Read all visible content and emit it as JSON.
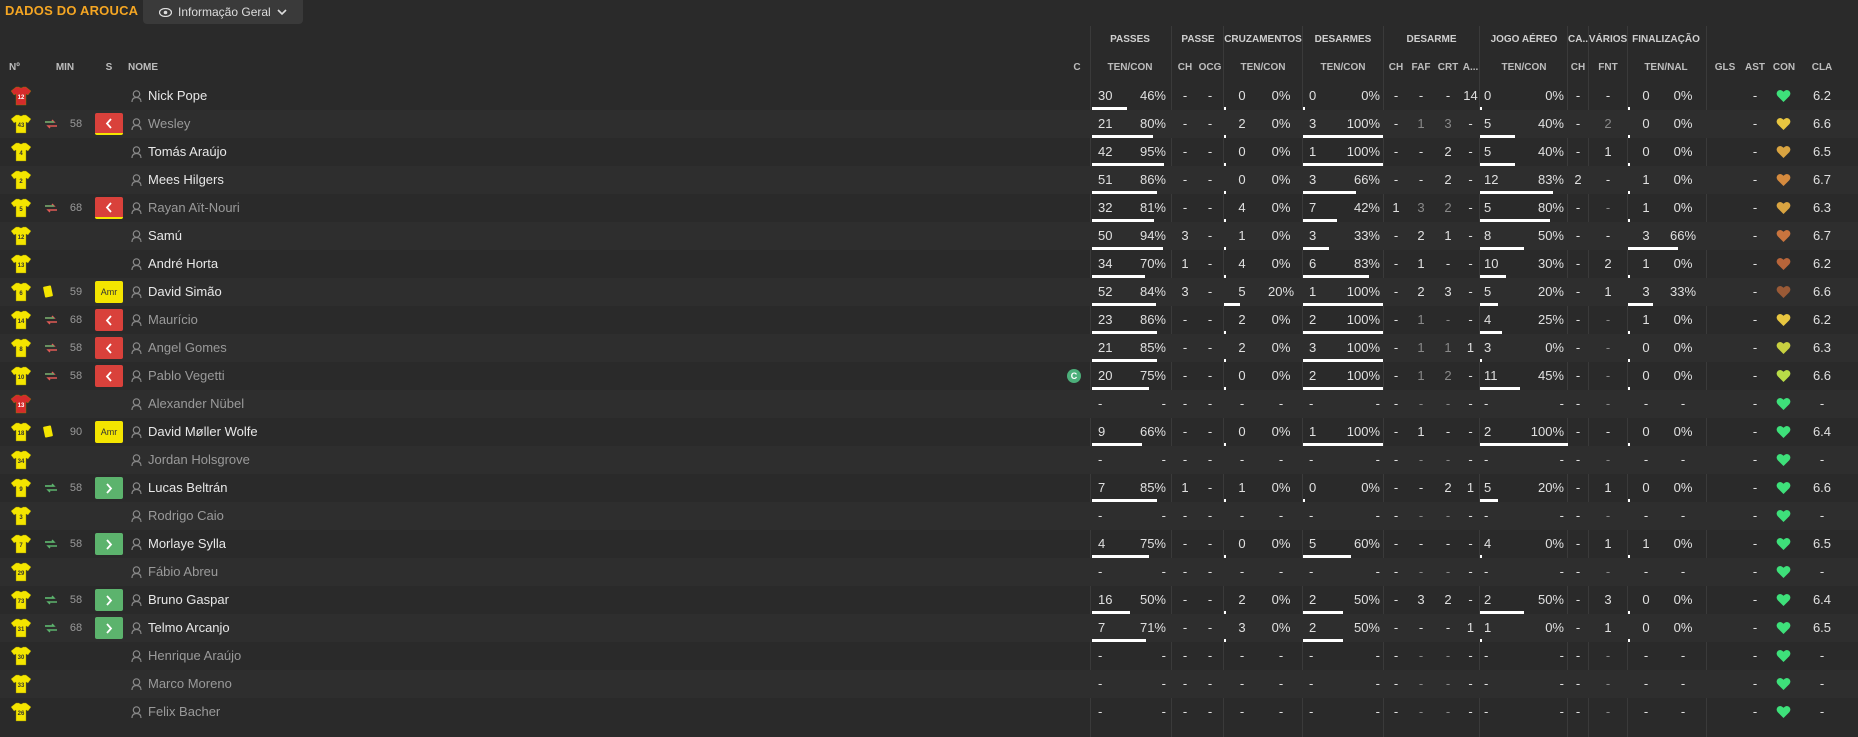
{
  "header": {
    "club_title": "DADOS DO AROUCA",
    "view_label": "Informação Geral",
    "groups": [
      "PASSES",
      "PASSE",
      "CRUZAMENTOS",
      "DESARMES",
      "DESARME",
      "JOGO AÉREO",
      "CA...",
      "VÁRIOS",
      "FINALIZAÇÃO"
    ],
    "columns": {
      "num": "Nº",
      "min": "MIN",
      "s": "S",
      "nome": "NOME",
      "c": "C",
      "pas": "TEN/CON",
      "pch": "CH",
      "pocg": "OCG",
      "cruz": "TEN/CON",
      "des": "TEN/CON",
      "dch": "CH",
      "dfaf": "FAF",
      "dcrt": "CRT",
      "da": "A...",
      "aer": "TEN/CON",
      "cach": "CH",
      "fnt": "FNT",
      "fin": "TEN/NAL",
      "gls": "GLS",
      "ast": "AST",
      "con": "CON",
      "cla": "CLA"
    }
  },
  "colors": {
    "accent": "#f5a623",
    "shirt": "#f4e500",
    "gk_shirt": "#d42b2b",
    "sub_on": "#5cb36d",
    "sub_off": "#d9413b"
  },
  "rows": [
    {
      "num": "12",
      "gk": true,
      "min": "",
      "event": "",
      "status": "",
      "name": "Nick Pope",
      "unused": false,
      "cap": false,
      "pas_t": "30",
      "pas_p": "46%",
      "pch": "-",
      "pocg": "-",
      "cr_t": "0",
      "cr_p": "0%",
      "de_t": "0",
      "de_p": "0%",
      "dch": "-",
      "dfaf": "-",
      "dcrt": "-",
      "da": "14",
      "ae_t": "0",
      "ae_p": "0%",
      "cach": "-",
      "fnt": "-",
      "fi_t": "0",
      "fi_p": "0%",
      "gls": "",
      "ast": "-",
      "con": "#3ee07a",
      "cla": "6.2"
    },
    {
      "num": "43",
      "gk": false,
      "min": "58",
      "event": "sub",
      "status": "off",
      "name": "Wesley",
      "unused": true,
      "cap": false,
      "pas_t": "21",
      "pas_p": "80%",
      "pch": "-",
      "pocg": "-",
      "cr_t": "2",
      "cr_p": "0%",
      "de_t": "3",
      "de_p": "100%",
      "dch": "-",
      "dfaf": "1",
      "dcrt": "3",
      "da": "-",
      "ae_t": "5",
      "ae_p": "40%",
      "cach": "-",
      "fnt": "2",
      "fi_t": "0",
      "fi_p": "0%",
      "gls": "",
      "ast": "-",
      "con": "#e8c640",
      "cla": "6.6"
    },
    {
      "num": "4",
      "gk": false,
      "min": "",
      "event": "",
      "status": "",
      "name": "Tomás Araújo",
      "unused": false,
      "cap": false,
      "pas_t": "42",
      "pas_p": "95%",
      "pch": "-",
      "pocg": "-",
      "cr_t": "0",
      "cr_p": "0%",
      "de_t": "1",
      "de_p": "100%",
      "dch": "-",
      "dfaf": "-",
      "dcrt": "2",
      "da": "-",
      "ae_t": "5",
      "ae_p": "40%",
      "cach": "-",
      "fnt": "1",
      "fi_t": "0",
      "fi_p": "0%",
      "gls": "",
      "ast": "-",
      "con": "#d9a441",
      "cla": "6.5"
    },
    {
      "num": "2",
      "gk": false,
      "min": "",
      "event": "",
      "status": "",
      "name": "Mees Hilgers",
      "unused": false,
      "cap": false,
      "pas_t": "51",
      "pas_p": "86%",
      "pch": "-",
      "pocg": "-",
      "cr_t": "0",
      "cr_p": "0%",
      "de_t": "3",
      "de_p": "66%",
      "dch": "-",
      "dfaf": "-",
      "dcrt": "2",
      "da": "-",
      "ae_t": "12",
      "ae_p": "83%",
      "cach": "2",
      "fnt": "-",
      "fi_t": "1",
      "fi_p": "0%",
      "gls": "",
      "ast": "-",
      "con": "#d58a3e",
      "cla": "6.7"
    },
    {
      "num": "5",
      "gk": false,
      "min": "68",
      "event": "sub",
      "status": "off",
      "name": "Rayan Aït-Nouri",
      "unused": true,
      "cap": false,
      "pas_t": "32",
      "pas_p": "81%",
      "pch": "-",
      "pocg": "-",
      "cr_t": "4",
      "cr_p": "0%",
      "de_t": "7",
      "de_p": "42%",
      "dch": "1",
      "dfaf": "3",
      "dcrt": "2",
      "da": "-",
      "ae_t": "5",
      "ae_p": "80%",
      "cach": "-",
      "fnt": "-",
      "fi_t": "1",
      "fi_p": "0%",
      "gls": "",
      "ast": "-",
      "con": "#d9a441",
      "cla": "6.3"
    },
    {
      "num": "12",
      "gk": false,
      "min": "",
      "event": "",
      "status": "",
      "name": "Samú",
      "unused": false,
      "cap": false,
      "pas_t": "50",
      "pas_p": "94%",
      "pch": "3",
      "pocg": "-",
      "cr_t": "1",
      "cr_p": "0%",
      "de_t": "3",
      "de_p": "33%",
      "dch": "-",
      "dfaf": "2",
      "dcrt": "1",
      "da": "-",
      "ae_t": "8",
      "ae_p": "50%",
      "cach": "-",
      "fnt": "-",
      "fi_t": "3",
      "fi_p": "66%",
      "gls": "",
      "ast": "-",
      "con": "#c9743e",
      "cla": "6.7"
    },
    {
      "num": "13",
      "gk": false,
      "min": "",
      "event": "",
      "status": "",
      "name": "André Horta",
      "unused": false,
      "cap": false,
      "pas_t": "34",
      "pas_p": "70%",
      "pch": "1",
      "pocg": "-",
      "cr_t": "4",
      "cr_p": "0%",
      "de_t": "6",
      "de_p": "83%",
      "dch": "-",
      "dfaf": "1",
      "dcrt": "-",
      "da": "-",
      "ae_t": "10",
      "ae_p": "30%",
      "cach": "-",
      "fnt": "2",
      "fi_t": "1",
      "fi_p": "0%",
      "gls": "",
      "ast": "-",
      "con": "#b8653a",
      "cla": "6.2"
    },
    {
      "num": "6",
      "gk": false,
      "min": "59",
      "event": "card",
      "status": "amr",
      "name": "David Simão",
      "unused": false,
      "cap": false,
      "pas_t": "52",
      "pas_p": "84%",
      "pch": "3",
      "pocg": "-",
      "cr_t": "5",
      "cr_p": "20%",
      "de_t": "1",
      "de_p": "100%",
      "dch": "-",
      "dfaf": "2",
      "dcrt": "3",
      "da": "-",
      "ae_t": "5",
      "ae_p": "20%",
      "cach": "-",
      "fnt": "1",
      "fi_t": "3",
      "fi_p": "33%",
      "gls": "",
      "ast": "-",
      "con": "#9a5a36",
      "cla": "6.6"
    },
    {
      "num": "14",
      "gk": false,
      "min": "68",
      "event": "sub",
      "status": "off",
      "name": "Maurício",
      "unused": true,
      "cap": false,
      "pas_t": "23",
      "pas_p": "86%",
      "pch": "-",
      "pocg": "-",
      "cr_t": "2",
      "cr_p": "0%",
      "de_t": "2",
      "de_p": "100%",
      "dch": "-",
      "dfaf": "1",
      "dcrt": "-",
      "da": "-",
      "ae_t": "4",
      "ae_p": "25%",
      "cach": "-",
      "fnt": "-",
      "fi_t": "1",
      "fi_p": "0%",
      "gls": "",
      "ast": "-",
      "con": "#e8c640",
      "cla": "6.2"
    },
    {
      "num": "8",
      "gk": false,
      "min": "58",
      "event": "sub",
      "status": "off",
      "name": "Angel Gomes",
      "unused": true,
      "cap": false,
      "pas_t": "21",
      "pas_p": "85%",
      "pch": "-",
      "pocg": "-",
      "cr_t": "2",
      "cr_p": "0%",
      "de_t": "3",
      "de_p": "100%",
      "dch": "-",
      "dfaf": "1",
      "dcrt": "1",
      "da": "1",
      "ae_t": "3",
      "ae_p": "0%",
      "cach": "-",
      "fnt": "-",
      "fi_t": "0",
      "fi_p": "0%",
      "gls": "",
      "ast": "-",
      "con": "#c8d040",
      "cla": "6.3"
    },
    {
      "num": "10",
      "gk": false,
      "min": "58",
      "event": "sub",
      "status": "off",
      "name": "Pablo Vegetti",
      "unused": true,
      "cap": true,
      "pas_t": "20",
      "pas_p": "75%",
      "pch": "-",
      "pocg": "-",
      "cr_t": "0",
      "cr_p": "0%",
      "de_t": "2",
      "de_p": "100%",
      "dch": "-",
      "dfaf": "1",
      "dcrt": "2",
      "da": "-",
      "ae_t": "11",
      "ae_p": "45%",
      "cach": "-",
      "fnt": "-",
      "fi_t": "0",
      "fi_p": "0%",
      "gls": "",
      "ast": "-",
      "con": "#b8dc48",
      "cla": "6.6"
    },
    {
      "num": "13",
      "gk": true,
      "min": "",
      "event": "",
      "status": "",
      "name": "Alexander Nübel",
      "unused": true,
      "cap": false,
      "pas_t": "-",
      "pas_p": "-",
      "pch": "-",
      "pocg": "-",
      "cr_t": "-",
      "cr_p": "-",
      "de_t": "-",
      "de_p": "-",
      "dch": "-",
      "dfaf": "-",
      "dcrt": "-",
      "da": "-",
      "ae_t": "-",
      "ae_p": "-",
      "cach": "-",
      "fnt": "-",
      "fi_t": "-",
      "fi_p": "-",
      "gls": "",
      "ast": "-",
      "con": "#3ee07a",
      "cla": "-"
    },
    {
      "num": "18",
      "gk": false,
      "min": "90",
      "event": "card",
      "status": "amr",
      "name": "David Møller Wolfe",
      "unused": false,
      "cap": false,
      "pas_t": "9",
      "pas_p": "66%",
      "pch": "-",
      "pocg": "-",
      "cr_t": "0",
      "cr_p": "0%",
      "de_t": "1",
      "de_p": "100%",
      "dch": "-",
      "dfaf": "1",
      "dcrt": "-",
      "da": "-",
      "ae_t": "2",
      "ae_p": "100%",
      "cach": "-",
      "fnt": "-",
      "fi_t": "0",
      "fi_p": "0%",
      "gls": "",
      "ast": "-",
      "con": "#3ee07a",
      "cla": "6.4"
    },
    {
      "num": "34",
      "gk": false,
      "min": "",
      "event": "",
      "status": "",
      "name": "Jordan Holsgrove",
      "unused": true,
      "cap": false,
      "pas_t": "-",
      "pas_p": "-",
      "pch": "-",
      "pocg": "-",
      "cr_t": "-",
      "cr_p": "-",
      "de_t": "-",
      "de_p": "-",
      "dch": "-",
      "dfaf": "-",
      "dcrt": "-",
      "da": "-",
      "ae_t": "-",
      "ae_p": "-",
      "cach": "-",
      "fnt": "-",
      "fi_t": "-",
      "fi_p": "-",
      "gls": "",
      "ast": "-",
      "con": "#3ee07a",
      "cla": "-"
    },
    {
      "num": "9",
      "gk": false,
      "min": "58",
      "event": "subon",
      "status": "on",
      "name": "Lucas Beltrán",
      "unused": false,
      "cap": false,
      "pas_t": "7",
      "pas_p": "85%",
      "pch": "1",
      "pocg": "-",
      "cr_t": "1",
      "cr_p": "0%",
      "de_t": "0",
      "de_p": "0%",
      "dch": "-",
      "dfaf": "-",
      "dcrt": "2",
      "da": "1",
      "ae_t": "5",
      "ae_p": "20%",
      "cach": "-",
      "fnt": "1",
      "fi_t": "0",
      "fi_p": "0%",
      "gls": "",
      "ast": "-",
      "con": "#3ee07a",
      "cla": "6.6"
    },
    {
      "num": "3",
      "gk": false,
      "min": "",
      "event": "",
      "status": "",
      "name": "Rodrigo Caio",
      "unused": true,
      "cap": false,
      "pas_t": "-",
      "pas_p": "-",
      "pch": "-",
      "pocg": "-",
      "cr_t": "-",
      "cr_p": "-",
      "de_t": "-",
      "de_p": "-",
      "dch": "-",
      "dfaf": "-",
      "dcrt": "-",
      "da": "-",
      "ae_t": "-",
      "ae_p": "-",
      "cach": "-",
      "fnt": "-",
      "fi_t": "-",
      "fi_p": "-",
      "gls": "",
      "ast": "-",
      "con": "#3ee07a",
      "cla": "-"
    },
    {
      "num": "7",
      "gk": false,
      "min": "58",
      "event": "subon",
      "status": "on",
      "name": "Morlaye Sylla",
      "unused": false,
      "cap": false,
      "pas_t": "4",
      "pas_p": "75%",
      "pch": "-",
      "pocg": "-",
      "cr_t": "0",
      "cr_p": "0%",
      "de_t": "5",
      "de_p": "60%",
      "dch": "-",
      "dfaf": "-",
      "dcrt": "-",
      "da": "-",
      "ae_t": "4",
      "ae_p": "0%",
      "cach": "-",
      "fnt": "1",
      "fi_t": "1",
      "fi_p": "0%",
      "gls": "",
      "ast": "-",
      "con": "#3ee07a",
      "cla": "6.5"
    },
    {
      "num": "29",
      "gk": false,
      "min": "",
      "event": "",
      "status": "",
      "name": "Fábio Abreu",
      "unused": true,
      "cap": false,
      "pas_t": "-",
      "pas_p": "-",
      "pch": "-",
      "pocg": "-",
      "cr_t": "-",
      "cr_p": "-",
      "de_t": "-",
      "de_p": "-",
      "dch": "-",
      "dfaf": "-",
      "dcrt": "-",
      "da": "-",
      "ae_t": "-",
      "ae_p": "-",
      "cach": "-",
      "fnt": "-",
      "fi_t": "-",
      "fi_p": "-",
      "gls": "",
      "ast": "-",
      "con": "#3ee07a",
      "cla": "-"
    },
    {
      "num": "73",
      "gk": false,
      "min": "58",
      "event": "subon",
      "status": "on",
      "name": "Bruno Gaspar",
      "unused": false,
      "cap": false,
      "pas_t": "16",
      "pas_p": "50%",
      "pch": "-",
      "pocg": "-",
      "cr_t": "2",
      "cr_p": "0%",
      "de_t": "2",
      "de_p": "50%",
      "dch": "-",
      "dfaf": "3",
      "dcrt": "2",
      "da": "-",
      "ae_t": "2",
      "ae_p": "50%",
      "cach": "-",
      "fnt": "3",
      "fi_t": "0",
      "fi_p": "0%",
      "gls": "",
      "ast": "-",
      "con": "#3ee07a",
      "cla": "6.4"
    },
    {
      "num": "31",
      "gk": false,
      "min": "68",
      "event": "subon",
      "status": "on",
      "name": "Telmo Arcanjo",
      "unused": false,
      "cap": false,
      "pas_t": "7",
      "pas_p": "71%",
      "pch": "-",
      "pocg": "-",
      "cr_t": "3",
      "cr_p": "0%",
      "de_t": "2",
      "de_p": "50%",
      "dch": "-",
      "dfaf": "-",
      "dcrt": "-",
      "da": "1",
      "ae_t": "1",
      "ae_p": "0%",
      "cach": "-",
      "fnt": "1",
      "fi_t": "0",
      "fi_p": "0%",
      "gls": "",
      "ast": "-",
      "con": "#3ee07a",
      "cla": "6.5"
    },
    {
      "num": "30",
      "gk": false,
      "min": "",
      "event": "",
      "status": "",
      "name": "Henrique Araújo",
      "unused": true,
      "cap": false,
      "pas_t": "-",
      "pas_p": "-",
      "pch": "-",
      "pocg": "-",
      "cr_t": "-",
      "cr_p": "-",
      "de_t": "-",
      "de_p": "-",
      "dch": "-",
      "dfaf": "-",
      "dcrt": "-",
      "da": "-",
      "ae_t": "-",
      "ae_p": "-",
      "cach": "-",
      "fnt": "-",
      "fi_t": "-",
      "fi_p": "-",
      "gls": "",
      "ast": "-",
      "con": "#3ee07a",
      "cla": "-"
    },
    {
      "num": "33",
      "gk": false,
      "min": "",
      "event": "",
      "status": "",
      "name": "Marco Moreno",
      "unused": true,
      "cap": false,
      "pas_t": "-",
      "pas_p": "-",
      "pch": "-",
      "pocg": "-",
      "cr_t": "-",
      "cr_p": "-",
      "de_t": "-",
      "de_p": "-",
      "dch": "-",
      "dfaf": "-",
      "dcrt": "-",
      "da": "-",
      "ae_t": "-",
      "ae_p": "-",
      "cach": "-",
      "fnt": "-",
      "fi_t": "-",
      "fi_p": "-",
      "gls": "",
      "ast": "-",
      "con": "#3ee07a",
      "cla": "-"
    },
    {
      "num": "26",
      "gk": false,
      "min": "",
      "event": "",
      "status": "",
      "name": "Felix Bacher",
      "unused": true,
      "cap": false,
      "pas_t": "-",
      "pas_p": "-",
      "pch": "-",
      "pocg": "-",
      "cr_t": "-",
      "cr_p": "-",
      "de_t": "-",
      "de_p": "-",
      "dch": "-",
      "dfaf": "-",
      "dcrt": "-",
      "da": "-",
      "ae_t": "-",
      "ae_p": "-",
      "cach": "-",
      "fnt": "-",
      "fi_t": "-",
      "fi_p": "-",
      "gls": "",
      "ast": "-",
      "con": "#3ee07a",
      "cla": "-"
    }
  ]
}
